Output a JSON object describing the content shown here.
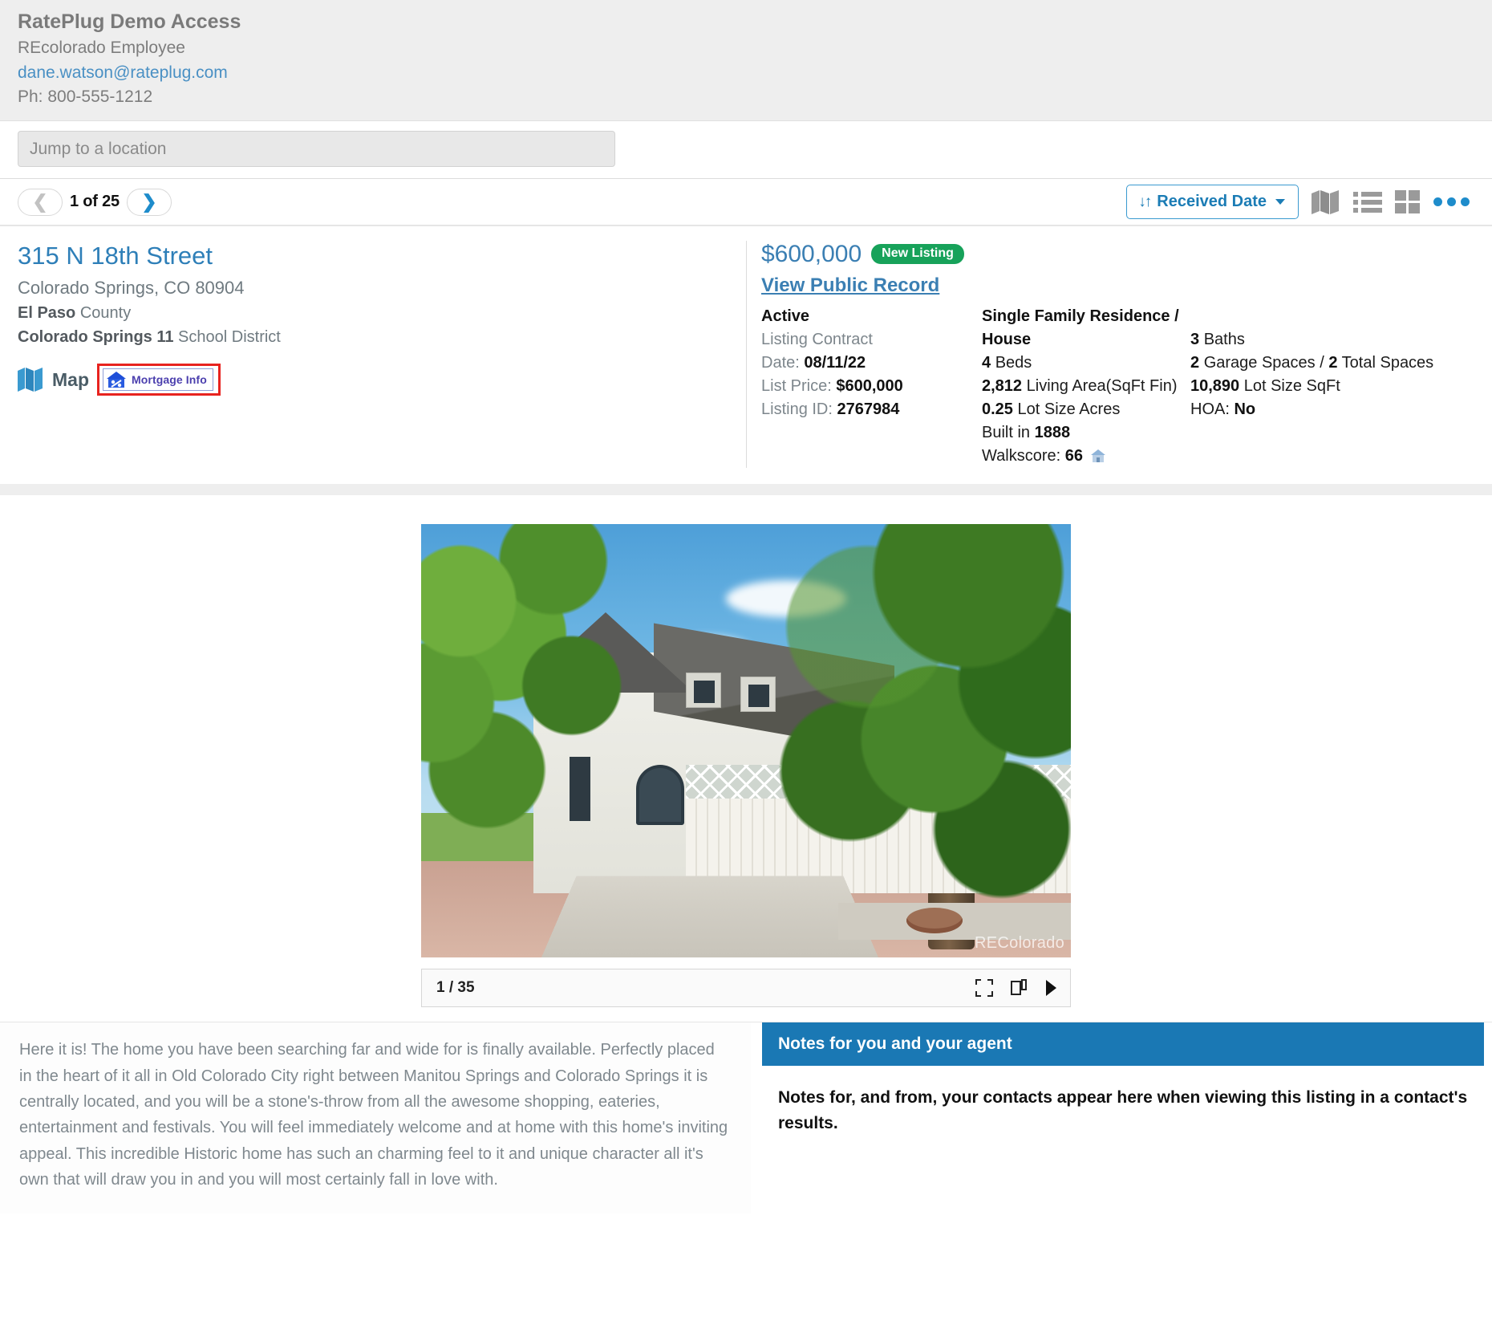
{
  "agent": {
    "name": "RatePlug Demo Access",
    "role": "REcolorado Employee",
    "email": "dane.watson@rateplug.com",
    "phone": "Ph: 800-555-1212"
  },
  "search": {
    "placeholder": "Jump to a location",
    "value": ""
  },
  "toolbar": {
    "pager_count": "1 of 25",
    "prev_icon": "chevron-left-icon",
    "next_icon": "chevron-right-icon",
    "sort_label": "Received Date",
    "sort_icon": "sort-arrows-icon",
    "view_map_icon": "map-view-icon",
    "view_list_icon": "list-view-icon",
    "view_grid_icon": "grid-view-icon",
    "more_icon": "more-options-icon",
    "accent_color": "#1e8ccb"
  },
  "listing": {
    "address": "315 N 18th Street",
    "city_state_zip": "Colorado Springs, CO 80904",
    "county_name": "El Paso",
    "county_suffix": "County",
    "school_district_name": "Colorado Springs 11",
    "school_district_suffix": "School District",
    "map_label": "Map",
    "map_icon": "map-icon",
    "mortgage_label": "Mortgage Info",
    "mortgage_icon": "house-percent-icon",
    "highlight_color": "#e8231f",
    "price": "$600,000",
    "badge": "New Listing",
    "badge_color": "#17a25a",
    "public_record_link": "View Public Record",
    "status": "Active",
    "listing_contract_label": "Listing Contract",
    "date_label": "Date:",
    "date_value": "08/11/22",
    "list_price_label": "List Price:",
    "list_price_value": "$600,000",
    "listing_id_label": "Listing ID:",
    "listing_id_value": "2767984",
    "property_type": "Single Family Residence / House",
    "beds_value": "4",
    "beds_label": "Beds",
    "baths_value": "3",
    "baths_label": "Baths",
    "living_area_value": "2,812",
    "living_area_label": "Living Area(SqFt Fin)",
    "garage_value": "2",
    "garage_label": "Garage Spaces /",
    "total_spaces_value": "2",
    "total_spaces_label": "Total Spaces",
    "lot_acres_value": "0.25",
    "lot_acres_label": "Lot Size Acres",
    "lot_sqft_value": "10,890",
    "lot_sqft_label": "Lot Size SqFt",
    "built_label": "Built in",
    "built_value": "1888",
    "hoa_label": "HOA:",
    "hoa_value": "No",
    "walkscore_label": "Walkscore:",
    "walkscore_value": "66",
    "walkscore_icon": "house-icon"
  },
  "photo": {
    "counter": "1 / 35",
    "watermark": "REColorado",
    "fullscreen_icon": "fullscreen-icon",
    "duplicate_icon": "duplicate-icon",
    "play_icon": "play-icon"
  },
  "description": {
    "text": "Here it is! The home you have been searching far and wide for is finally available. Perfectly placed in the heart of it all in Old Colorado City right between Manitou Springs and Colorado Springs it is centrally located, and you will be a stone's-throw from all the awesome shopping, eateries, entertainment and festivals. You will feel immediately welcome and at home with this home's inviting appeal. This incredible Historic home has such an charming feel to it and unique character all it's own that will draw you in and you will most certainly fall in love with."
  },
  "notes": {
    "header": "Notes for you and your agent",
    "body": "Notes for, and from, your contacts appear here when viewing this listing in a contact's results.",
    "header_color": "#1a78b4"
  }
}
